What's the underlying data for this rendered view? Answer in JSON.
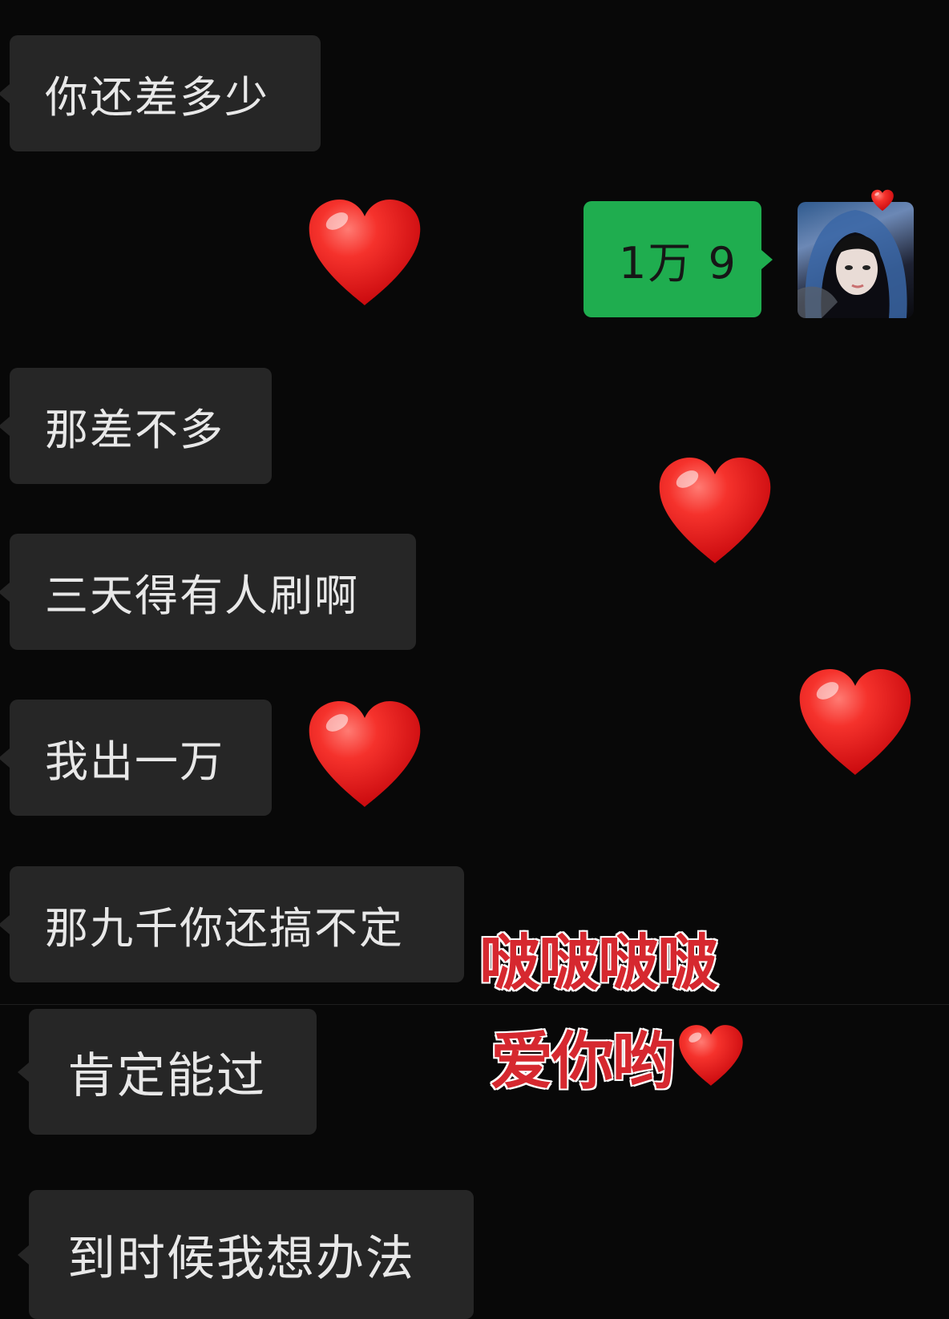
{
  "messages": [
    {
      "side": "incoming",
      "text": "你还差多少"
    },
    {
      "side": "outgoing",
      "text": "1万 9"
    },
    {
      "side": "incoming",
      "text": "那差不多"
    },
    {
      "side": "incoming",
      "text": "三天得有人刷啊"
    },
    {
      "side": "incoming",
      "text": "我出一万"
    },
    {
      "side": "incoming",
      "text": "那九千你还搞不定"
    },
    {
      "side": "incoming",
      "text": "肯定能过"
    },
    {
      "side": "incoming",
      "text": "到时候我想办法"
    }
  ],
  "sticker": {
    "line1": "啵啵啵啵",
    "line2": "爱你哟",
    "color": "#d6282f",
    "outline": "#ffffff"
  },
  "colors": {
    "background": "#080808",
    "incoming_bubble": "#262626",
    "outgoing_bubble": "#1fad4f",
    "heart": "#e8191c"
  },
  "icons": {
    "heart": "red-heart-emoji",
    "avatar": "user-avatar-photo"
  }
}
